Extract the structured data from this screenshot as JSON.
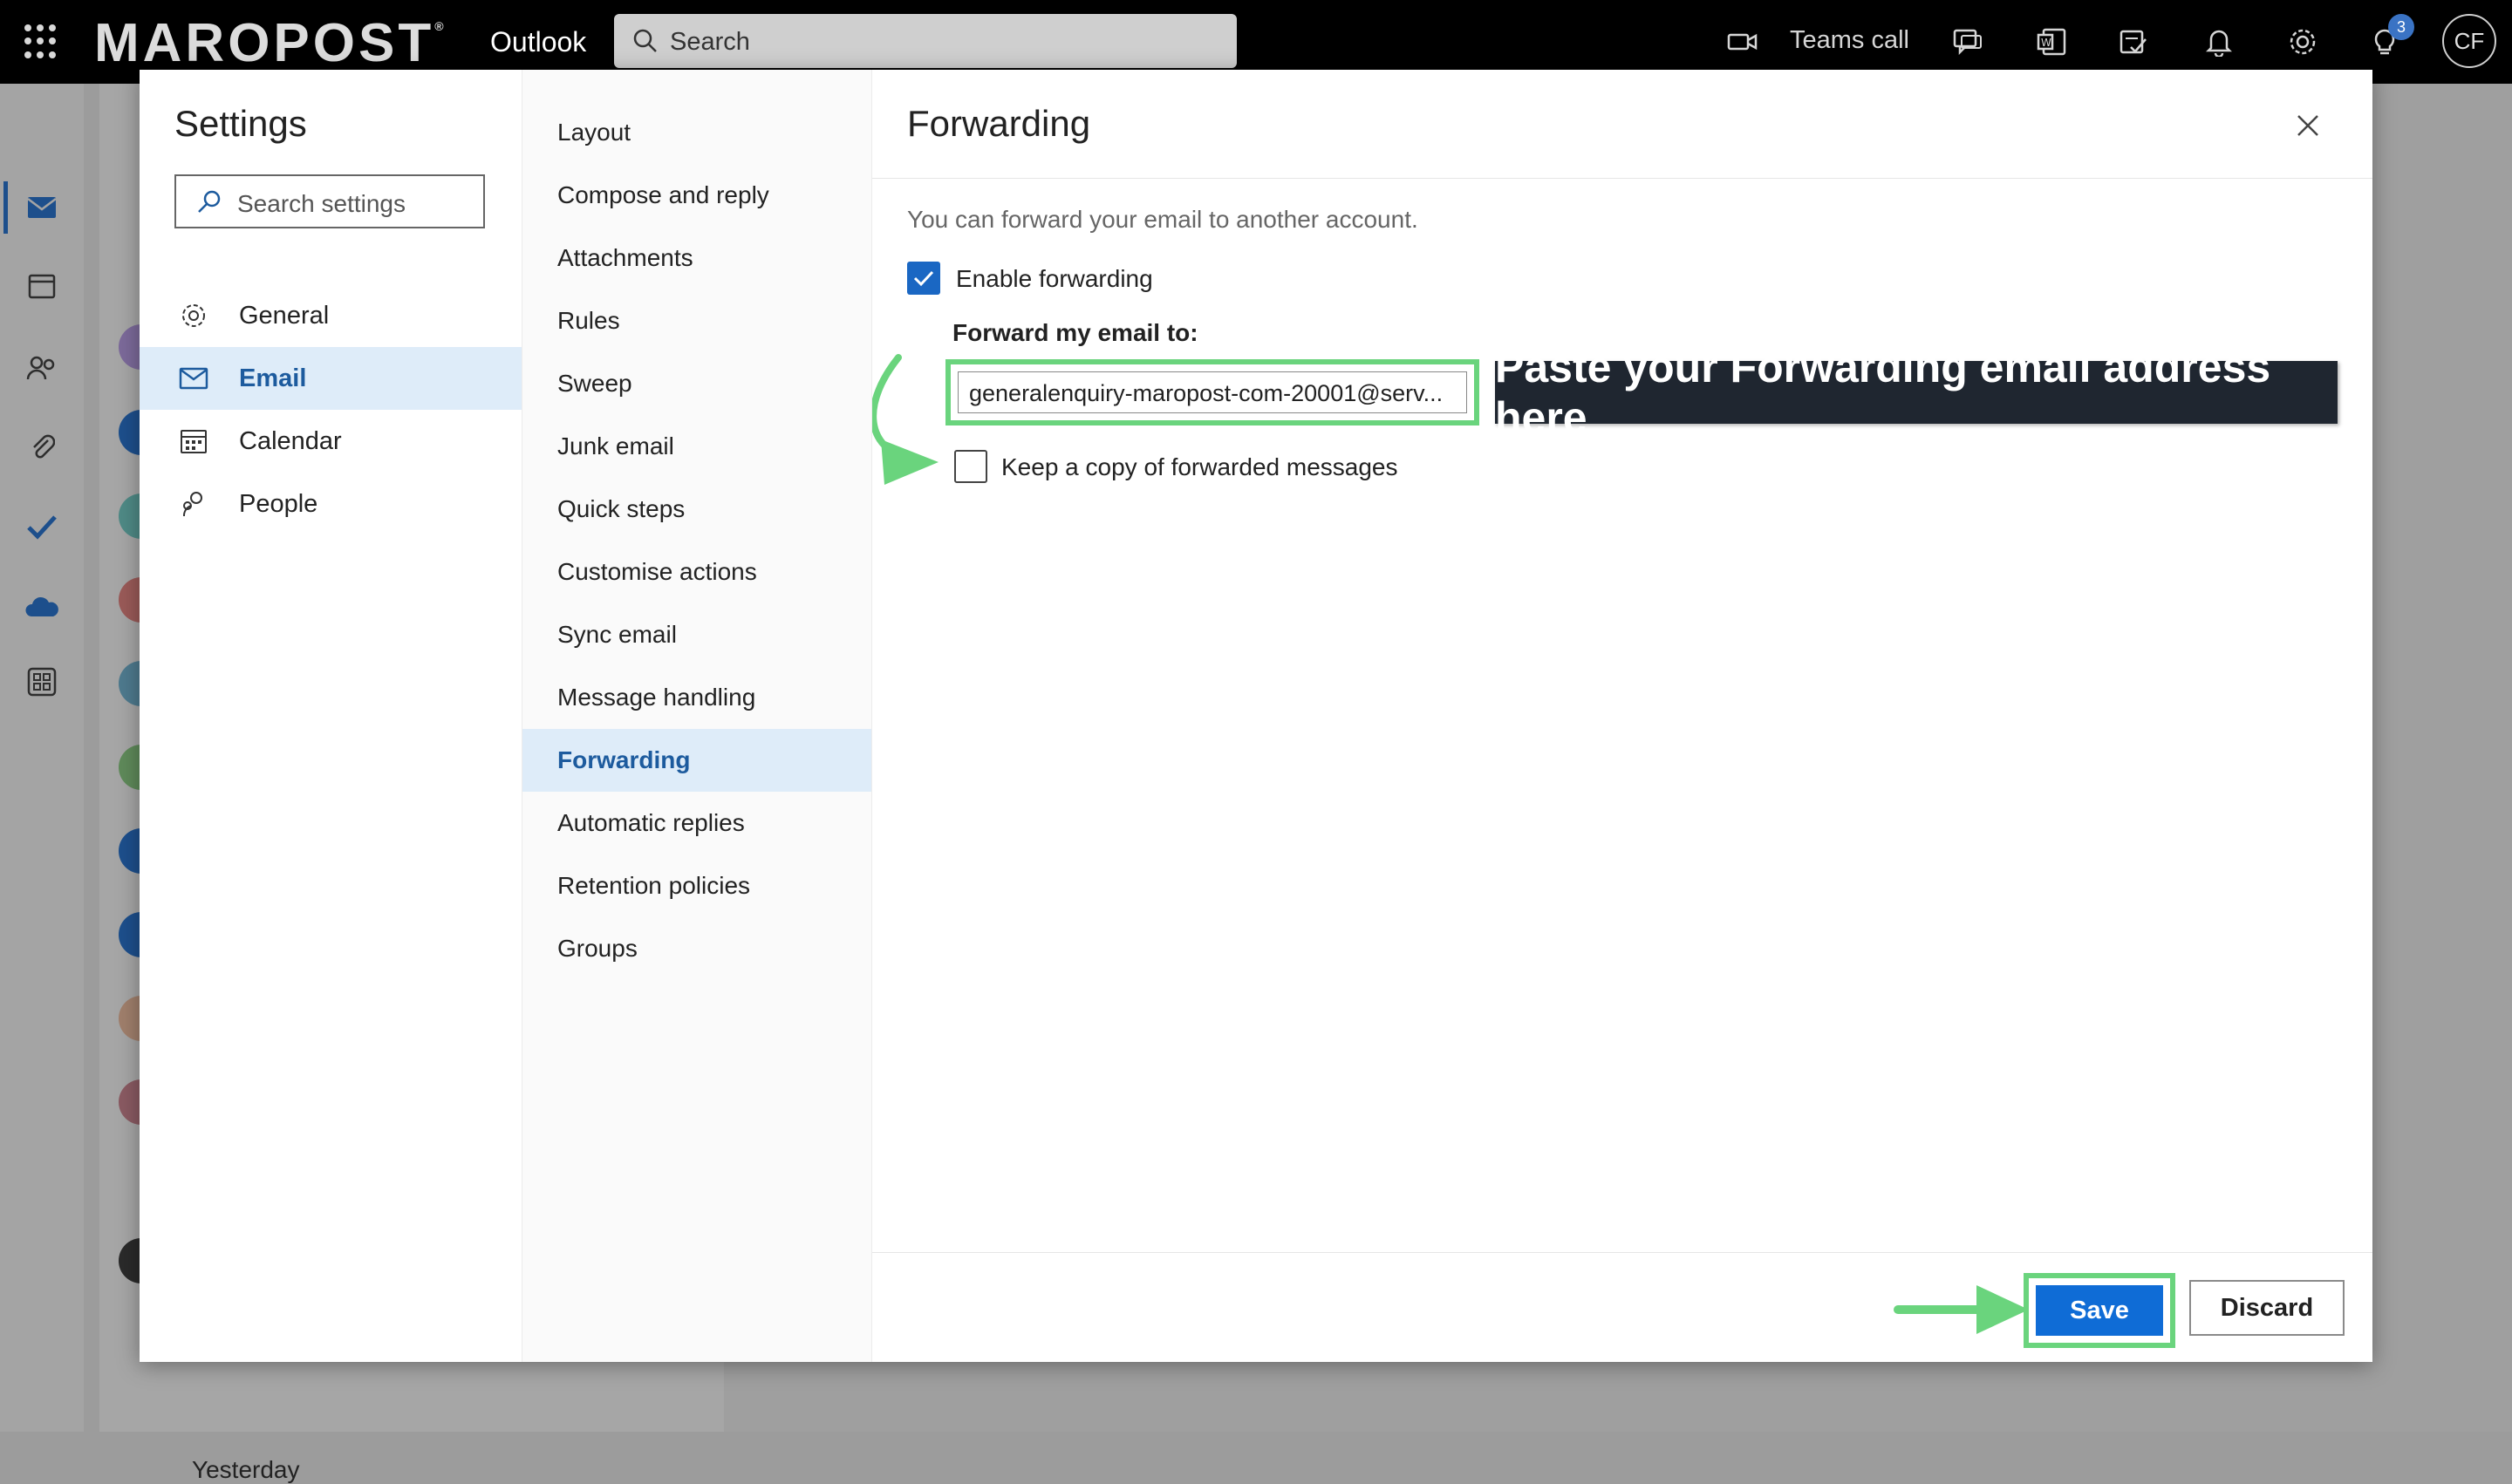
{
  "topbar": {
    "brand": "MAROPOST",
    "brand_mark": "®",
    "app_name": "Outlook",
    "search_placeholder": "Search",
    "teams_call_label": "Teams call",
    "notification_badge": "3",
    "user_initials": "CF"
  },
  "background": {
    "date_group": "Yesterday"
  },
  "settings": {
    "title": "Settings",
    "search_placeholder": "Search settings",
    "categories": [
      {
        "label": "General",
        "icon": "gear-icon"
      },
      {
        "label": "Email",
        "icon": "mail-icon",
        "selected": true
      },
      {
        "label": "Calendar",
        "icon": "calendar-icon"
      },
      {
        "label": "People",
        "icon": "people-icon"
      }
    ],
    "email_sections": [
      "Layout",
      "Compose and reply",
      "Attachments",
      "Rules",
      "Sweep",
      "Junk email",
      "Quick steps",
      "Customise actions",
      "Sync email",
      "Message handling",
      "Forwarding",
      "Automatic replies",
      "Retention policies",
      "Groups"
    ],
    "selected_section": "Forwarding"
  },
  "forwarding": {
    "title": "Forwarding",
    "intro": "You can forward your email to another account.",
    "enable_label": "Enable forwarding",
    "enable_checked": true,
    "forward_to_label": "Forward my email to:",
    "forward_to_value": "generalenquiry-maropost-com-20001@serv...",
    "keep_copy_label": "Keep a copy of forwarded messages",
    "keep_copy_checked": false,
    "save_label": "Save",
    "discard_label": "Discard"
  },
  "annotation": {
    "callout_text": "Paste your Forwarding email address here",
    "highlight_color": "#6ad47d"
  },
  "colors": {
    "accent": "#0f6cd6",
    "selected_bg": "#deecf9",
    "selected_text": "#1d5b9e",
    "topbar_bg": "#000000"
  }
}
